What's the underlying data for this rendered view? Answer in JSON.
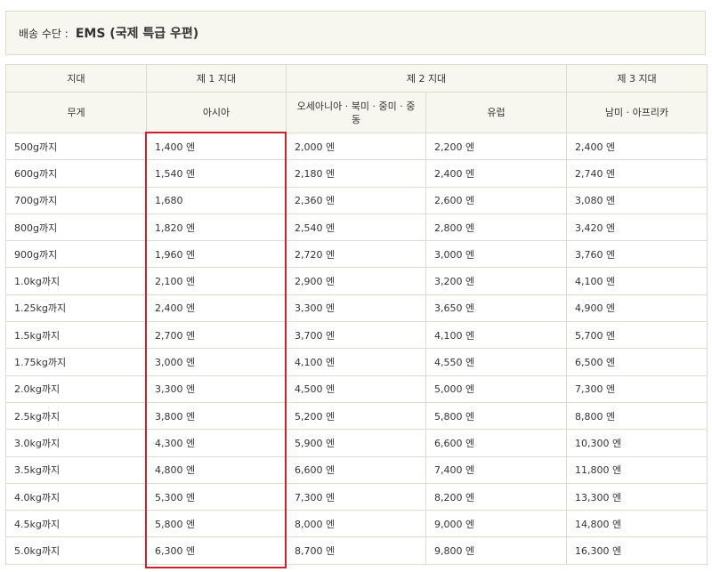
{
  "shipping": {
    "label": "배송 수단 :",
    "method": "EMS (국제 특급 우편)"
  },
  "table": {
    "header_zone_label": "지대",
    "header_zone1": "제 1 지대",
    "header_zone2": "제 2 지대",
    "header_zone3": "제 3 지대",
    "header_weight": "무게",
    "header_asia": "아시아",
    "header_oceania": "오세아니아 · 북미 · 중미 · 중동",
    "header_europe": "유럽",
    "header_southam": "남미 · 아프리카",
    "rows": [
      {
        "weight": "500g까지",
        "z1": "1,400 엔",
        "z2a": "2,000 엔",
        "z2b": "2,200 엔",
        "z3": "2,400 엔"
      },
      {
        "weight": "600g까지",
        "z1": "1,540 엔",
        "z2a": "2,180 엔",
        "z2b": "2,400 엔",
        "z3": "2,740 엔"
      },
      {
        "weight": "700g까지",
        "z1": "1,680",
        "z2a": "2,360 엔",
        "z2b": "2,600 엔",
        "z3": "3,080 엔"
      },
      {
        "weight": "800g까지",
        "z1": "1,820 엔",
        "z2a": "2,540 엔",
        "z2b": "2,800 엔",
        "z3": "3,420 엔"
      },
      {
        "weight": "900g까지",
        "z1": "1,960 엔",
        "z2a": "2,720 엔",
        "z2b": "3,000 엔",
        "z3": "3,760 엔"
      },
      {
        "weight": "1.0kg까지",
        "z1": "2,100 엔",
        "z2a": "2,900 엔",
        "z2b": "3,200 엔",
        "z3": "4,100 엔"
      },
      {
        "weight": "1.25kg까지",
        "z1": "2,400 엔",
        "z2a": "3,300 엔",
        "z2b": "3,650 엔",
        "z3": "4,900 엔"
      },
      {
        "weight": "1.5kg까지",
        "z1": "2,700 엔",
        "z2a": "3,700 엔",
        "z2b": "4,100 엔",
        "z3": "5,700 엔"
      },
      {
        "weight": "1.75kg까지",
        "z1": "3,000 엔",
        "z2a": "4,100 엔",
        "z2b": "4,550 엔",
        "z3": "6,500 엔"
      },
      {
        "weight": "2.0kg까지",
        "z1": "3,300 엔",
        "z2a": "4,500 엔",
        "z2b": "5,000 엔",
        "z3": "7,300 엔"
      },
      {
        "weight": "2.5kg까지",
        "z1": "3,800 엔",
        "z2a": "5,200 엔",
        "z2b": "5,800 엔",
        "z3": "8,800 엔"
      },
      {
        "weight": "3.0kg까지",
        "z1": "4,300 엔",
        "z2a": "5,900 엔",
        "z2b": "6,600 엔",
        "z3": "10,300 엔"
      },
      {
        "weight": "3.5kg까지",
        "z1": "4,800 엔",
        "z2a": "6,600 엔",
        "z2b": "7,400 엔",
        "z3": "11,800 엔"
      },
      {
        "weight": "4.0kg까지",
        "z1": "5,300 엔",
        "z2a": "7,300 엔",
        "z2b": "8,200 엔",
        "z3": "13,300 엔"
      },
      {
        "weight": "4.5kg까지",
        "z1": "5,800 엔",
        "z2a": "8,000 엔",
        "z2b": "9,000 엔",
        "z3": "14,800 엔"
      },
      {
        "weight": "5.0kg까지",
        "z1": "6,300 엔",
        "z2a": "8,700 엔",
        "z2b": "9,800 엔",
        "z3": "16,300 엔"
      }
    ]
  },
  "colors": {
    "header_bg": "#f7f7ef",
    "border": "#dcdccf",
    "highlight": "#d0202a"
  }
}
